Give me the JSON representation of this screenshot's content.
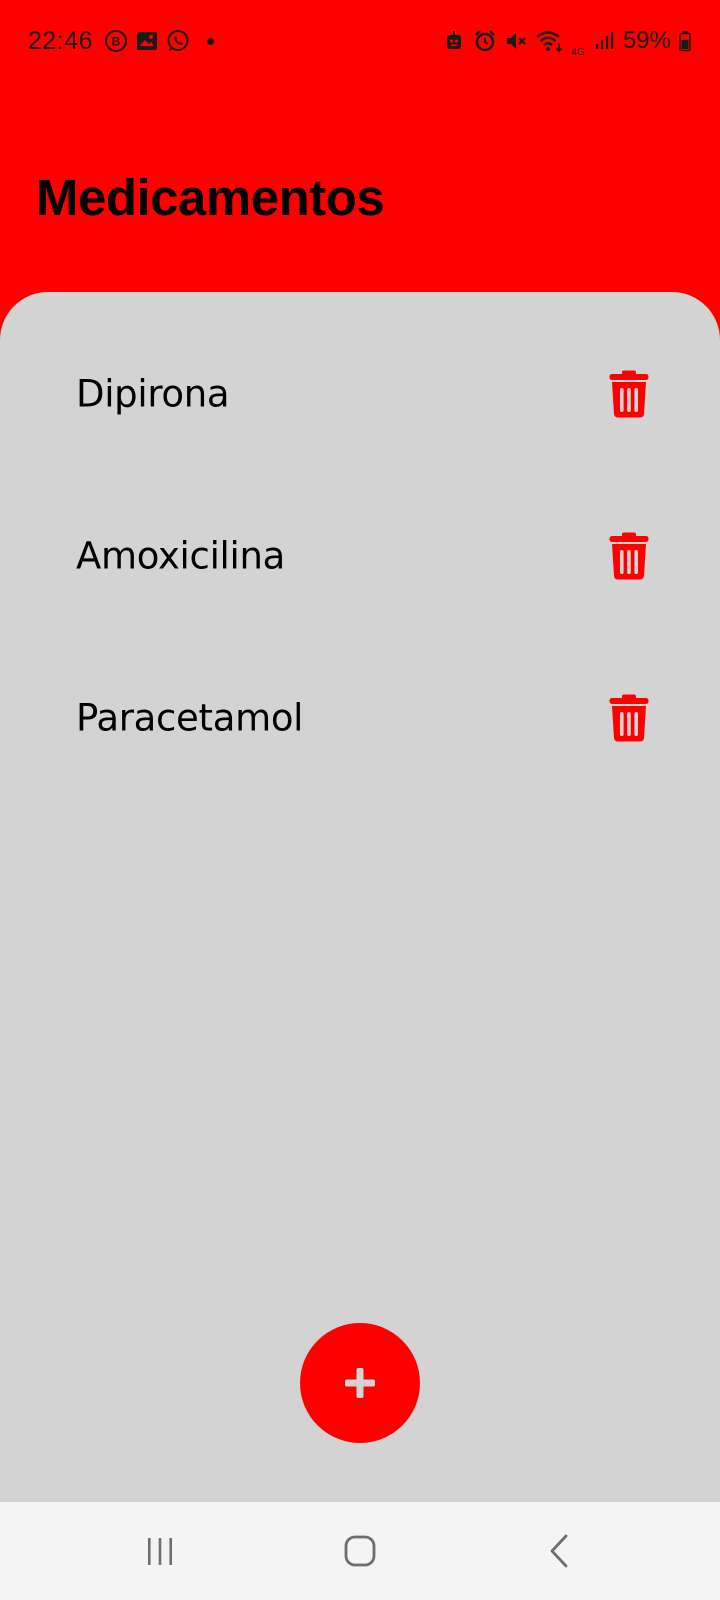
{
  "status_bar": {
    "time": "22:46",
    "left_icons": [
      "b-circle-icon",
      "gallery-icon",
      "whatsapp-icon"
    ],
    "right_icons": [
      "robot-icon",
      "alarm-icon",
      "mute-icon",
      "wifi-icon",
      "signal-icon",
      "battery-icon"
    ],
    "network_type": "4G",
    "battery_percent": "59%"
  },
  "header": {
    "title": "Medicamentos"
  },
  "medications": [
    {
      "name": "Dipirona"
    },
    {
      "name": "Amoxicilina"
    },
    {
      "name": "Paracetamol"
    }
  ],
  "colors": {
    "primary": "#ff0000",
    "panel": "#d3d3d3",
    "nav_bar": "#f4f4f4",
    "fab_icon": "#d3d3d3"
  },
  "fab": {
    "icon": "plus-icon"
  },
  "nav_bar": {
    "buttons": [
      "recent-apps-icon",
      "home-icon",
      "back-icon"
    ]
  }
}
